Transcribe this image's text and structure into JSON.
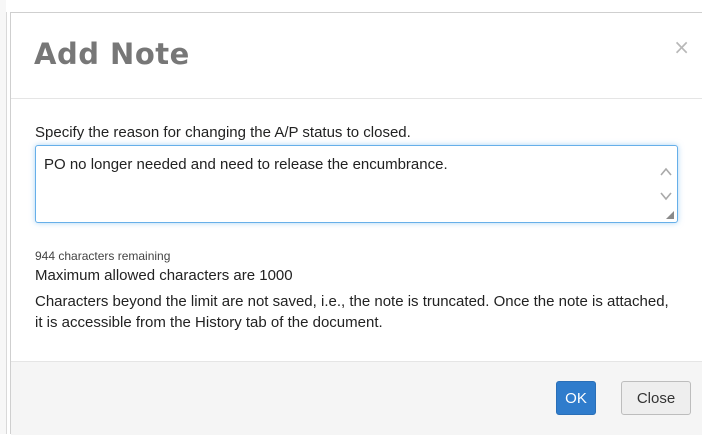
{
  "dialog": {
    "title": "Add Note",
    "close_icon": "close-icon",
    "close_glyph": "×"
  },
  "body": {
    "prompt": "Specify the reason for changing the A/P status to closed.",
    "note_value": "PO no longer needed and need to release the encumbrance.",
    "chars_remaining": "944 characters remaining",
    "max_allowed": "Maximum allowed characters are 1000",
    "truncate_info": "Characters beyond the limit are not saved, i.e., the note is truncated. Once the note is attached, it is accessible from the History tab of the document."
  },
  "footer": {
    "ok_label": "OK",
    "close_label": "Close"
  },
  "colors": {
    "primary": "#2f7ccc",
    "focus": "#66afe9",
    "title": "#777777"
  }
}
